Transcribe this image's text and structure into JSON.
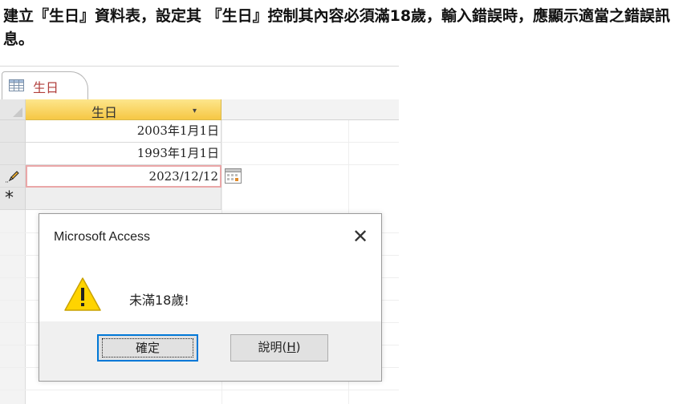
{
  "instruction": "建立『生日』資料表，設定其 『生日』控制其內容必須滿18歲，輸入錯誤時，應顯示適當之錯誤訊息。",
  "tab": {
    "label": "生日",
    "icon": "table-icon"
  },
  "column": {
    "header": "生日",
    "dropdown": "▾"
  },
  "rows": [
    {
      "value": "2003年1月1日"
    },
    {
      "value": "1993年1月1日"
    },
    {
      "value": "2023/12/12",
      "state": "editing"
    }
  ],
  "new_row_marker": "*",
  "dialog": {
    "title": "Microsoft Access",
    "close": "✕",
    "message": "未滿18歲!",
    "ok_label": "確定",
    "help_label": "說明",
    "help_shortcut": "H"
  },
  "colors": {
    "tab_label": "#b13f3c",
    "column_header": "#f6c744",
    "editing_border": "#eaa7a8",
    "default_button_border": "#0078d7",
    "warning": "#ffd700"
  }
}
